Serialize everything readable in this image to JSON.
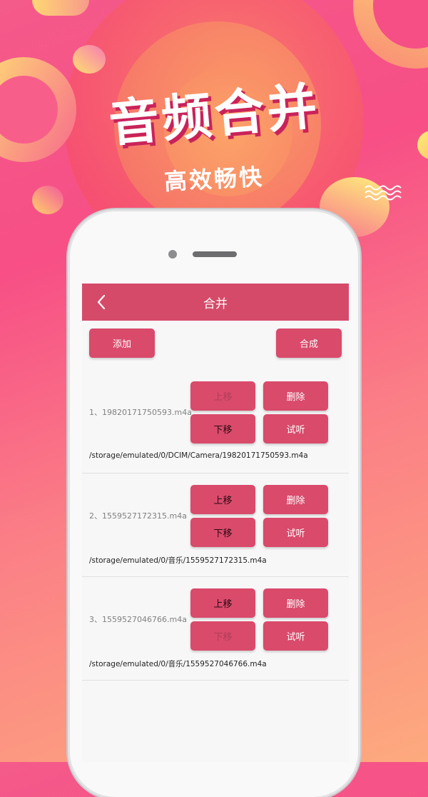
{
  "promo": {
    "headline": "音频合并",
    "subheadline": "高效畅快"
  },
  "colors": {
    "accent": "#d94a6b",
    "app_bar": "#d64a69",
    "screen_bg": "#f7f7f7"
  },
  "app_bar": {
    "back_icon": "chevron-left-icon",
    "title": "合并"
  },
  "toolbar": {
    "add_label": "添加",
    "merge_label": "合成"
  },
  "items": [
    {
      "name": "1、19820171750593.m4a",
      "path": "/storage/emulated/0/DCIM/Camera/19820171750593.m4a",
      "move_up_label": "上移",
      "move_up_enabled": false,
      "move_down_label": "下移",
      "move_down_enabled": true,
      "delete_label": "删除",
      "preview_label": "试听"
    },
    {
      "name": "2、1559527172315.m4a",
      "path": "/storage/emulated/0/音乐/1559527172315.m4a",
      "move_up_label": "上移",
      "move_up_enabled": true,
      "move_down_label": "下移",
      "move_down_enabled": true,
      "delete_label": "删除",
      "preview_label": "试听"
    },
    {
      "name": "3、1559527046766.m4a",
      "path": "/storage/emulated/0/音乐/1559527046766.m4a",
      "move_up_label": "上移",
      "move_up_enabled": true,
      "move_down_label": "下移",
      "move_down_enabled": false,
      "delete_label": "删除",
      "preview_label": "试听"
    }
  ]
}
